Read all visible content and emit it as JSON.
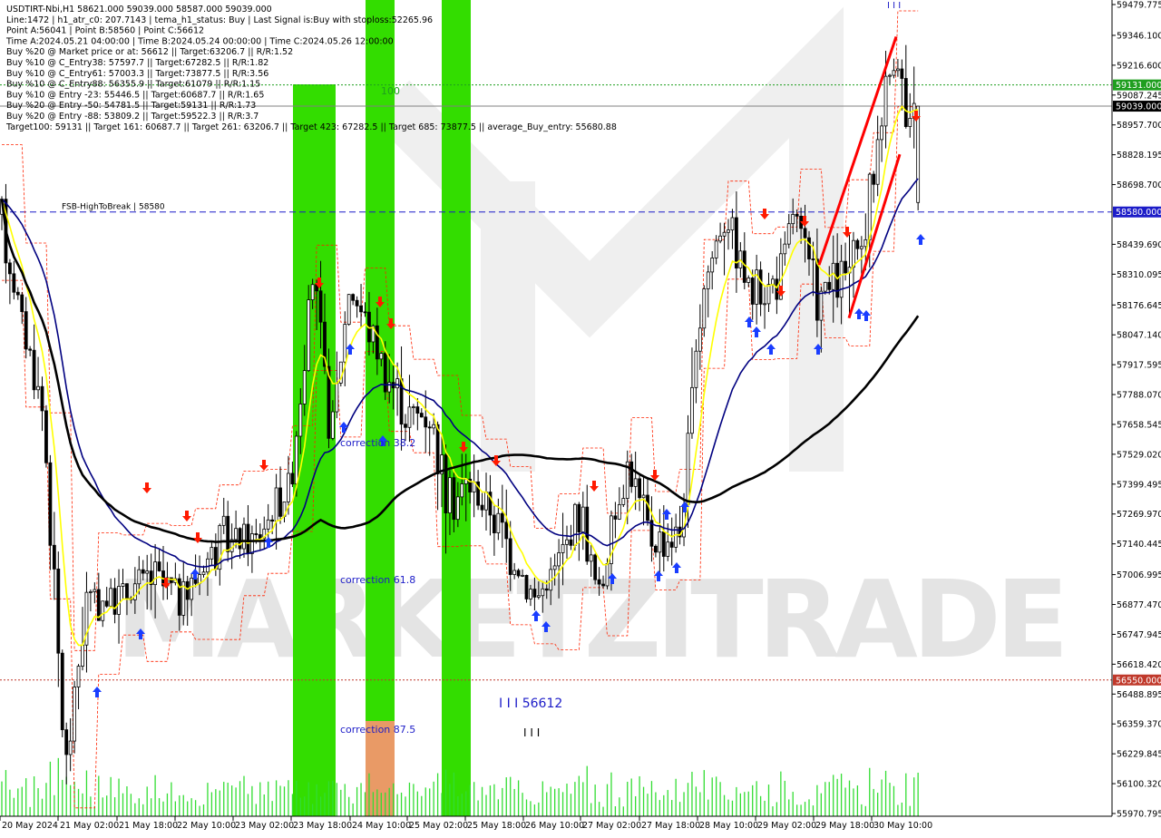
{
  "header": {
    "lines": [
      "USDTIRT-Nbi,H1  58621.000 59039.000 58587.000 59039.000",
      "Line:1472 | h1_atr_c0: 207.7143 | tema_h1_status: Buy | Last Signal is:Buy with stoploss:52265.96",
      "Point A:56041 | Point B:58560 | Point C:56612",
      "Time A:2024.05.21 04:00:00 | Time B:2024.05.24 00:00:00 | Time C:2024.05.26 12:00:00",
      "Buy %20 @ Market price or at: 56612 || Target:63206.7 || R/R:1.52",
      "Buy %10 @ C_Entry38: 57597.7 || Target:67282.5 || R/R:1.82",
      "Buy %10 @ C_Entry61: 57003.3 || Target:73877.5 || R/R:3.56",
      "Buy %10 @ C_Entry88: 56355.9 || Target:61079 || R/R:1.15",
      "Buy %10 @ Entry -23: 55446.5 || Target:60687.7 || R/R:1.65",
      "Buy %20 @ Entry -50: 54781.5 || Target:59131 || R/R:1.73",
      "Buy %20 @ Entry -88: 53809.2 || Target:59522.3 || R/R:3.7",
      "Target100: 59131 || Target 161: 60687.7 || Target 261: 63206.7 || Target 423: 67282.5 || Target 685: 73877.5 || average_Buy_entry: 55680.88"
    ]
  },
  "chart_data": {
    "type": "candlestick",
    "symbol": "USDTIRT-Nbi",
    "timeframe": "H1",
    "ohlc_last": {
      "open": 58621.0,
      "high": 59039.0,
      "low": 58587.0,
      "close": 59039.0
    },
    "price_axis": {
      "ticks": [
        59479.775,
        59346.1,
        59216.6,
        59087.245,
        58957.7,
        58828.195,
        58698.7,
        58439.69,
        58310.095,
        58176.645,
        58047.14,
        57917.595,
        57788.07,
        57658.545,
        57529.02,
        57399.495,
        57269.97,
        57140.445,
        57006.995,
        56877.47,
        56747.945,
        56618.42,
        56488.895,
        56359.37,
        56229.845,
        56100.32,
        55970.795
      ],
      "tick_labels": [
        "59479.775",
        "59346.100",
        "59216.600",
        "59087.245",
        "58957.700",
        "58828.195",
        "58698.700",
        "58439.690",
        "58310.095",
        "58176.645",
        "58047.140",
        "57917.595",
        "57788.070",
        "57658.545",
        "57529.020",
        "57399.495",
        "57269.970",
        "57140.445",
        "57006.995",
        "56877.470",
        "56747.945",
        "56618.420",
        "56488.895",
        "56359.370",
        "56229.845",
        "56100.320",
        "55970.795"
      ],
      "range": [
        55945,
        59490
      ]
    },
    "time_axis": {
      "labels": [
        "20 May 2024",
        "21 May 02:00",
        "21 May 18:00",
        "22 May 10:00",
        "23 May 02:00",
        "23 May 18:00",
        "24 May 10:00",
        "25 May 02:00",
        "25 May 18:00",
        "26 May 10:00",
        "27 May 02:00",
        "27 May 18:00",
        "28 May 10:00",
        "29 May 02:00",
        "29 May 18:00",
        "30 May 10:00"
      ]
    },
    "price_labels": [
      {
        "value": 59131.0,
        "text": "59131.000",
        "color": "#1f9e1f"
      },
      {
        "value": 59039.0,
        "text": "59039.000",
        "color": "#000000"
      },
      {
        "value": 58580.0,
        "text": "58580.000",
        "color": "#1c1cc8"
      },
      {
        "value": 56550.0,
        "text": "56550.000",
        "color": "#c0392b"
      }
    ],
    "horizontal_lines": [
      {
        "value": 59131.0,
        "style": "dotted",
        "color": "#1f9e1f"
      },
      {
        "value": 59039.0,
        "style": "solid",
        "color": "#808080"
      },
      {
        "value": 58580.0,
        "style": "dashed",
        "color": "#1c1cc8",
        "label": "FSB-HighToBreak | 58580"
      },
      {
        "value": 56550.0,
        "style": "dotted",
        "color": "#c0392b"
      }
    ],
    "annotations": [
      {
        "text": "100",
        "color": "#1f9e1f"
      },
      {
        "text": "correction 38.2",
        "color": "#1c1cc8"
      },
      {
        "text": "correction 61.8",
        "color": "#1c1cc8"
      },
      {
        "text": "correction 87.5",
        "color": "#1c1cc8"
      },
      {
        "text": "I I I 56612",
        "color": "#1c1cc8"
      }
    ],
    "watermark": "MARKETZITRADE",
    "colors": {
      "background": "#ffffff",
      "candle": "#000000",
      "ma_fast": "#ffff00",
      "ma_mid": "#000080",
      "ma_slow": "#000000",
      "envelope": "#ff2200",
      "green_zone": "#33dd00",
      "orange_zone": "#e99a66",
      "buy_arrow": "#1a3dff",
      "sell_arrow": "#ff1a00",
      "volume": "#33dd33"
    }
  }
}
